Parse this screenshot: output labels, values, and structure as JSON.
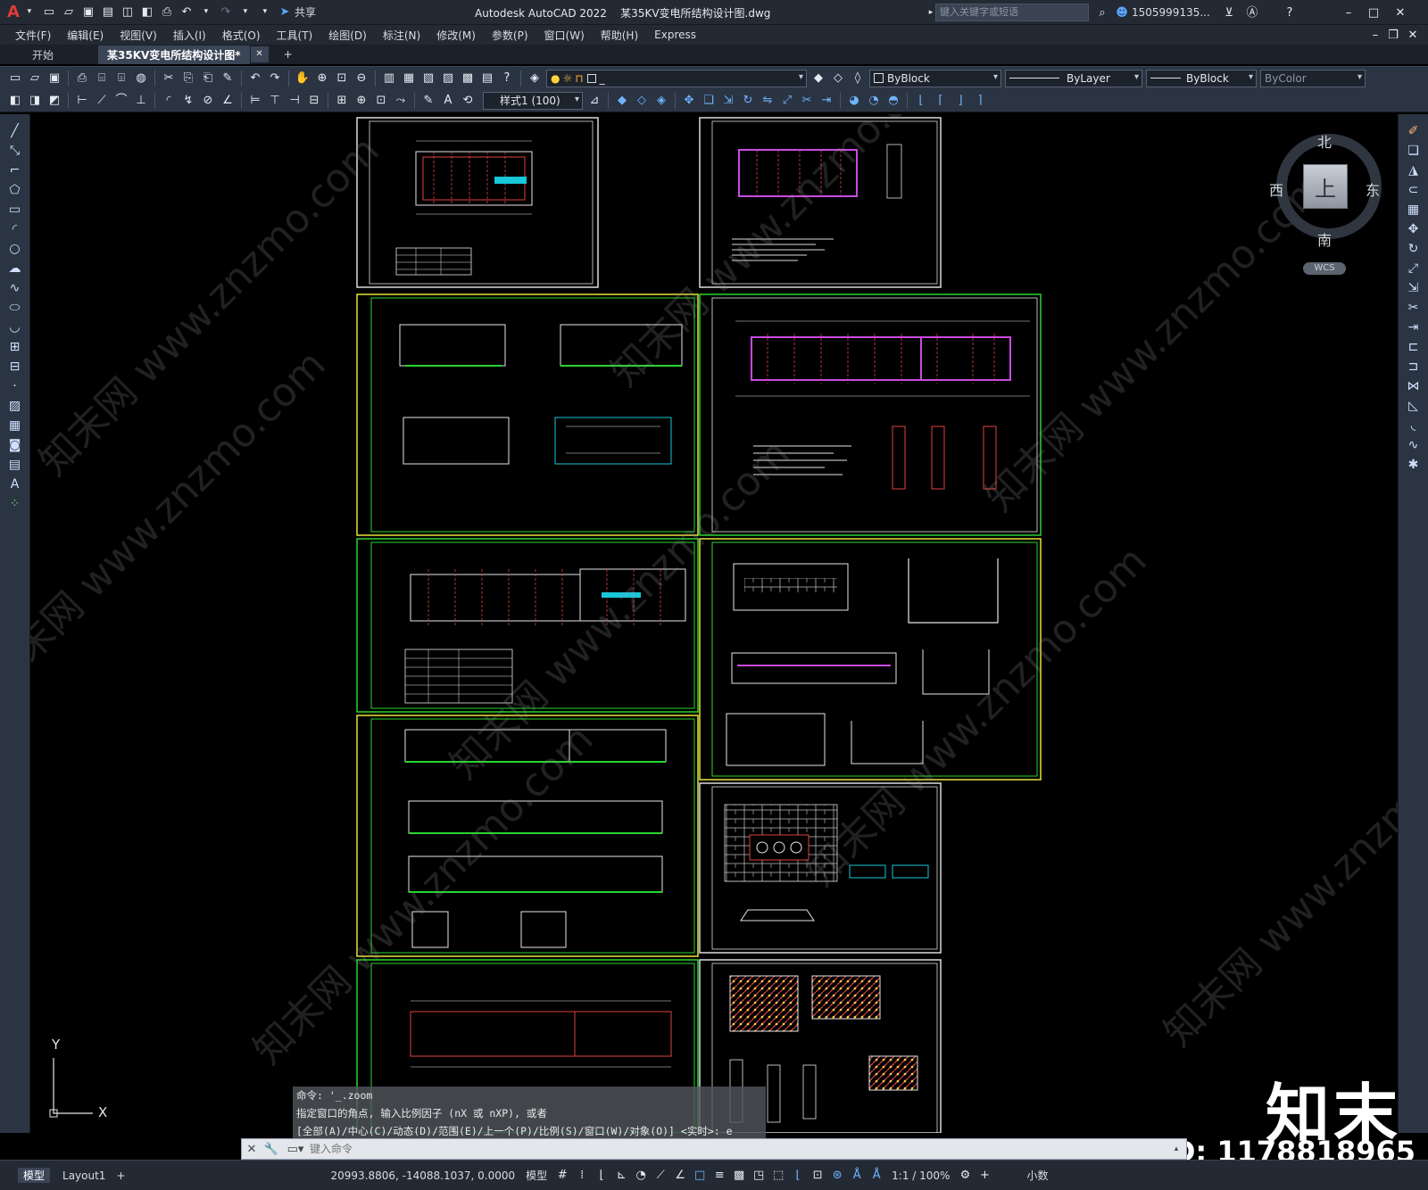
{
  "title_bar": {
    "app_logo": "A",
    "share_label": "共享",
    "title": "Autodesk AutoCAD 2022    某35KV变电所结构设计图.dwg",
    "search_placeholder": "键入关键字或短语",
    "user": "1505999135..."
  },
  "menu": [
    "文件(F)",
    "编辑(E)",
    "视图(V)",
    "插入(I)",
    "格式(O)",
    "工具(T)",
    "绘图(D)",
    "标注(N)",
    "修改(M)",
    "参数(P)",
    "窗口(W)",
    "帮助(H)",
    "Express"
  ],
  "doc_tabs": {
    "start": "开始",
    "active": "某35KV变电所结构设计图*",
    "add": "+"
  },
  "toolbar": {
    "layer_value": "_",
    "color": "ByBlock",
    "linetype": "ByLayer",
    "lineweight": "ByBlock",
    "plotstyle": "ByColor",
    "dimstyle": "样式1 (100)"
  },
  "viewcube": {
    "north": "北",
    "south": "南",
    "east": "东",
    "west": "西",
    "top": "上",
    "wcs": "WCS"
  },
  "ucs": {
    "x": "X",
    "y": "Y"
  },
  "command": {
    "history": [
      "命令: '_.zoom",
      "指定窗口的角点, 输入比例因子 (nX 或 nXP), 或者",
      "[全部(A)/中心(C)/动态(D)/范围(E)/上一个(P)/比例(S)/窗口(W)/对象(O)] <实时>: e"
    ],
    "placeholder": "键入命令"
  },
  "status_bar": {
    "model_tab": "模型",
    "layout_tab": "Layout1",
    "coords": "20993.8806, -14088.1037, 0.0000",
    "model_label": "模型",
    "scale": "1:1 / 100%",
    "units": "小数"
  },
  "watermark": {
    "brand": "知末",
    "id": "ID: 1178818965",
    "site": "知末网 www.znzmo.com"
  },
  "colors": {
    "bg": "#000000",
    "chrome": "#232a34",
    "sheet_green": "#27d631",
    "sheet_yellow": "#e7e23a"
  }
}
